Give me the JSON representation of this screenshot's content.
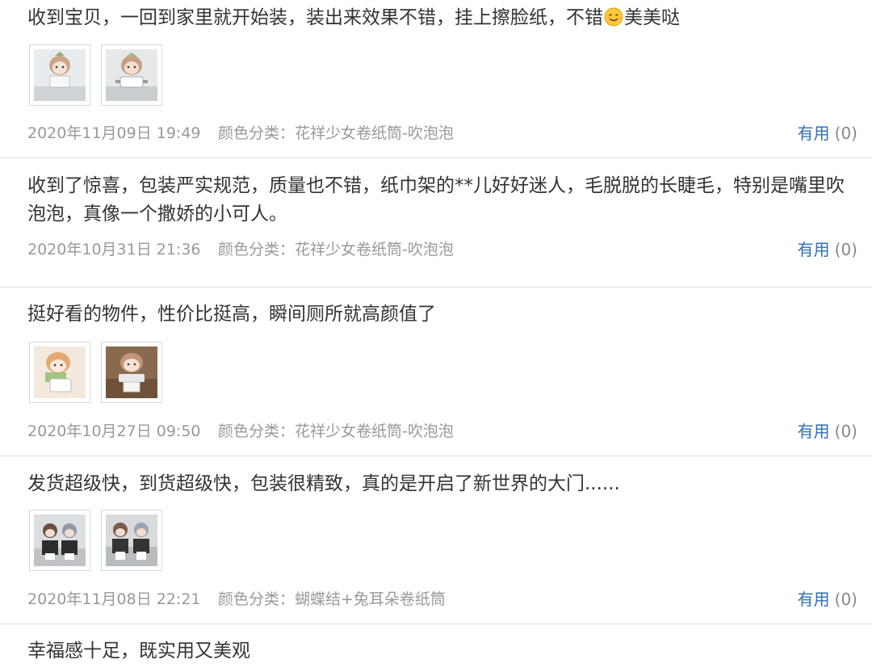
{
  "reviews": [
    {
      "text": "收到宝贝，一回到家里就开始装，装出来效果不错，挂上擦脸纸，不错",
      "text_after_emoji": "美美哒",
      "emoji_icon": "smiling-face-icon",
      "date": "2020年11月09日 19:49",
      "variant": "颜色分类：花祥少女卷纸筒-吹泡泡",
      "useful_label": "有用",
      "useful_count": "(0)"
    },
    {
      "text_line1": "收到了惊喜，包装严实规范，质量也不错，纸巾架的**儿好好迷人，毛脱脱的长睫毛，特别是嘴里吹",
      "text_line2": "泡泡，真像一个撒娇的小可人。",
      "date": "2020年10月31日 21:36",
      "variant": "颜色分类：花祥少女卷纸筒-吹泡泡",
      "useful_label": "有用",
      "useful_count": "(0)"
    },
    {
      "text": "挺好看的物件，性价比挺高，瞬间厕所就高颜值了",
      "date": "2020年10月27日 09:50",
      "variant": "颜色分类：花祥少女卷纸筒-吹泡泡",
      "useful_label": "有用",
      "useful_count": "(0)"
    },
    {
      "text": "发货超级快，到货超级快，包装很精致，真的是开启了新世界的大门......",
      "date": "2020年11月08日 22:21",
      "variant": "颜色分类：蝴蝶结+兔耳朵卷纸筒",
      "useful_label": "有用",
      "useful_count": "(0)"
    },
    {
      "text": "幸福感十足，既实用又美观"
    }
  ],
  "colors": {
    "text": "#333333",
    "meta": "#999999",
    "link": "#2d6fb8",
    "divider": "#dcdcdc"
  }
}
